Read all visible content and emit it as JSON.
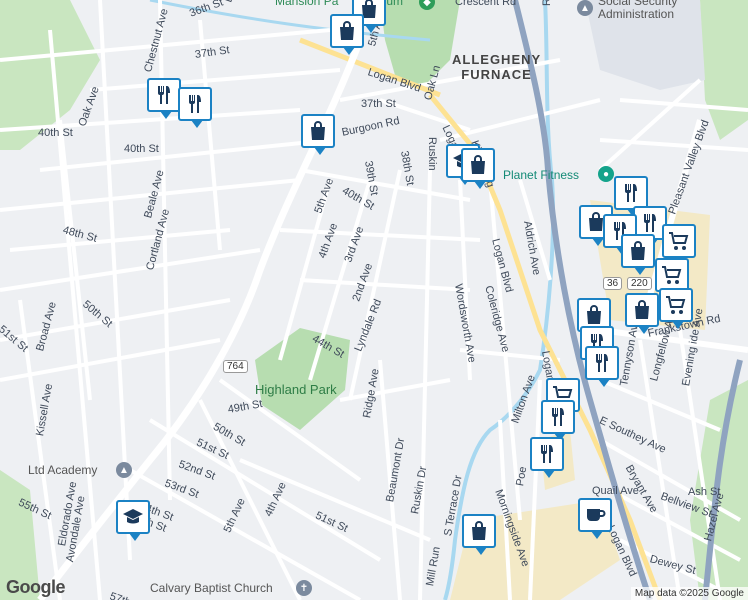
{
  "map": {
    "attribution": "Map data ©2025 Google",
    "logo_text": "Google",
    "area_labels": {
      "neighborhood": "ALLEGHENY\nFURNACE"
    },
    "route_badges": [
      "764",
      "36",
      "220"
    ],
    "places": [
      {
        "name": "Mansion Park Stadium",
        "display": "Mansion Pa",
        "tail": "um",
        "type": "stadium"
      },
      {
        "name": "Social Security Administration",
        "display": "Social Security\nAdministration",
        "type": "government"
      },
      {
        "name": "Planet Fitness",
        "display": "Planet Fitness",
        "type": "gym"
      },
      {
        "name": "Highland Park",
        "display": "Highland Park",
        "type": "park"
      },
      {
        "name": "Ltd Academy",
        "display": "Ltd Academy",
        "type": "school"
      },
      {
        "name": "Calvary Baptist Church",
        "display": "Calvary Baptist Church",
        "type": "church"
      }
    ],
    "streets": [
      "36th St",
      "Beale Ave",
      "37th St",
      "5th Ave",
      "Crescent Rd",
      "Run",
      "Chestnut Ave",
      "Logan Blvd",
      "Oak Ave",
      "40th St",
      "37th St",
      "Oak Ln",
      "40th St",
      "Burgoon Rd",
      "Logan",
      "Ruskin",
      "Kittanning",
      "39th St",
      "38th St",
      "Beale Ave",
      "5th Ave",
      "40th St",
      "Aldrich Ave",
      "Pleasant Valley Blvd",
      "48th St",
      "Cortland Ave",
      "4th Ave",
      "3rd Ave",
      "Logan Blvd",
      "2nd Ave",
      "50th St",
      "51st St",
      "Broad Ave",
      "Wordsworth Ave",
      "Coleridge Ave",
      "Lyndale Rd",
      "44th St",
      "Frankstown Rd",
      "Logan",
      "Tennyson Ave",
      "Longfellow Ave",
      "Evening ide Ave",
      "Ridge Ave",
      "Milton Ave",
      "49th St",
      "50th St",
      "Kissell Ave",
      "51st St",
      "E Southey Ave",
      "52nd St",
      "54th St",
      "53rd St",
      "Beaumont Dr",
      "Bryant Ave",
      "Ash St",
      "4th Ave",
      "5th Ave",
      "55th St",
      "Poe",
      "Quail Ave",
      "Bellview St",
      "54th St",
      "Ruskin Dr",
      "S Terrace Dr",
      "Morningside Ave",
      "Eldorado Ave",
      "Avondale Ave",
      "51st St",
      "Hazel Ave",
      "Mill Run",
      "Dewey St",
      "Logan Blvd",
      "57th St"
    ],
    "markers": [
      {
        "icon": "shopping-bag-icon"
      },
      {
        "icon": "shopping-bag-icon"
      },
      {
        "icon": "restaurant-icon"
      },
      {
        "icon": "restaurant-icon"
      },
      {
        "icon": "shopping-bag-icon"
      },
      {
        "icon": "school-icon"
      },
      {
        "icon": "shopping-bag-icon"
      },
      {
        "icon": "restaurant-icon"
      },
      {
        "icon": "shopping-bag-icon"
      },
      {
        "icon": "restaurant-icon"
      },
      {
        "icon": "restaurant-icon"
      },
      {
        "icon": "shopping-cart-icon"
      },
      {
        "icon": "shopping-bag-icon"
      },
      {
        "icon": "shopping-cart-icon"
      },
      {
        "icon": "shopping-cart-icon"
      },
      {
        "icon": "shopping-bag-icon"
      },
      {
        "icon": "shopping-bag-icon"
      },
      {
        "icon": "restaurant-icon"
      },
      {
        "icon": "shopping-cart-icon"
      },
      {
        "icon": "restaurant-icon"
      },
      {
        "icon": "restaurant-icon"
      },
      {
        "icon": "restaurant-icon"
      },
      {
        "icon": "school-icon"
      },
      {
        "icon": "shopping-bag-icon"
      },
      {
        "icon": "coffee-cup-icon"
      }
    ]
  },
  "colors": {
    "marker_border": "#1b82c4",
    "park": "#b7ddb0",
    "highway": "#8fa3c0",
    "river": "#a8d8f0",
    "commercial": "#f3e9c6"
  }
}
